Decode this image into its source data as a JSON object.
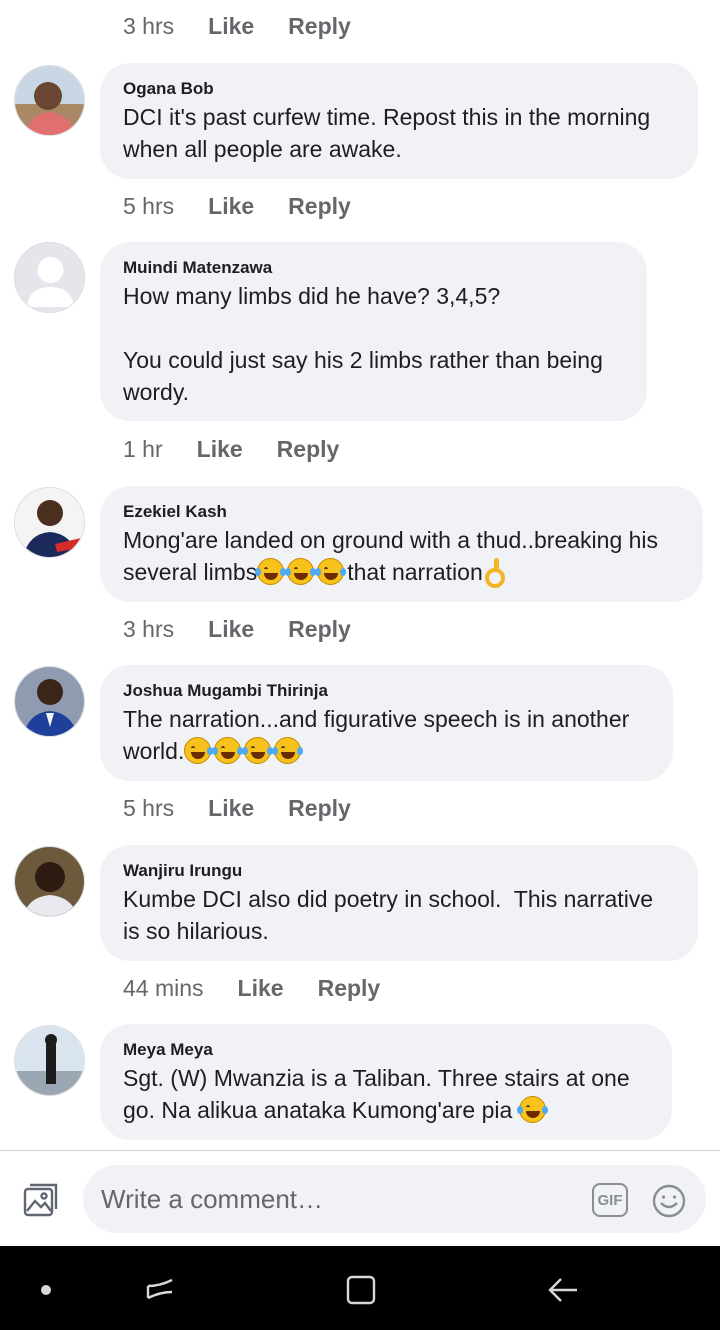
{
  "labels": {
    "like": "Like",
    "reply": "Reply"
  },
  "top_actions": {
    "time": "3 hrs"
  },
  "comments": [
    {
      "author": "Ogana Bob",
      "text": "DCI it's past curfew time. Repost this in the morning\nwhen all people are awake.",
      "time": "5 hrs"
    },
    {
      "author": "Muindi Matenzawa",
      "text": "How many limbs did he have? 3,4,5?\n\nYou could just say his 2 limbs rather than being\nwordy.",
      "time": "1 hr"
    },
    {
      "author": "Ezekiel Kash",
      "text_line1": "Mong'are landed on ground with a thud..breaking his",
      "text_line2a": "several limbs",
      "text_line2b": "that narration",
      "emojis": [
        "laughing-tears",
        "laughing-tears",
        "laughing-tears",
        "ok-hand"
      ],
      "time": "3 hrs"
    },
    {
      "author": "Joshua Mugambi Thirinja",
      "text_line1": "The narration...and figurative speech is in another",
      "text_line2a": "world.",
      "emojis": [
        "sweat-smile",
        "laughing-tears",
        "laughing-tears",
        "laughing-tears"
      ],
      "time": "5 hrs"
    },
    {
      "author": "Wanjiru Irungu",
      "text": "Kumbe DCI also did poetry in school.  This narrative\nis so hilarious.",
      "time": "44 mins"
    },
    {
      "author": "Meya Meya",
      "text_line1": "Sgt. (W) Mwanzia is a Taliban. Three stairs at one",
      "text_line2a": "go. Na alikua anataka Kumong'are pia ",
      "emojis": [
        "laughing-tears"
      ]
    }
  ],
  "composer": {
    "placeholder": "Write a comment…",
    "gif_label": "GIF"
  },
  "colors": {
    "bubble": "#f0f2f5",
    "meta": "#65676b",
    "text": "#1c1e21",
    "navbar": "#000000"
  }
}
